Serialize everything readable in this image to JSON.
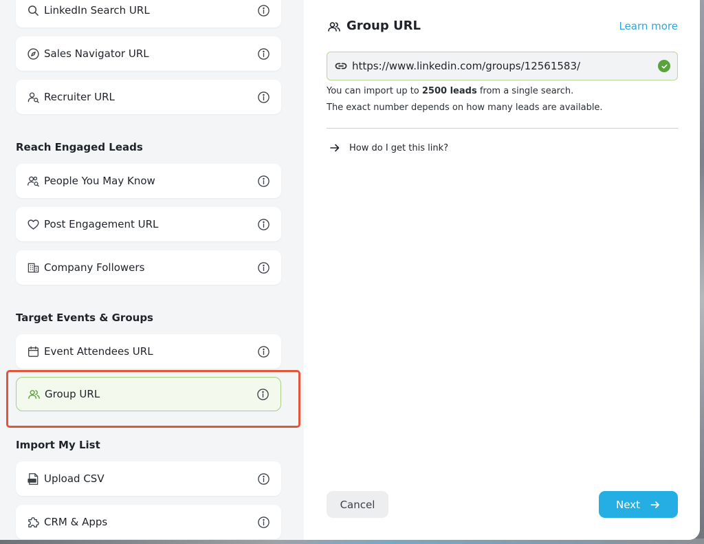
{
  "sidebar": {
    "sections": [
      {
        "title": "",
        "items": [
          {
            "label": "LinkedIn Search URL",
            "icon": "search-icon"
          },
          {
            "label": "Sales Navigator URL",
            "icon": "compass-icon"
          },
          {
            "label": "Recruiter URL",
            "icon": "user-search-icon"
          }
        ]
      },
      {
        "title": "Reach Engaged Leads",
        "items": [
          {
            "label": "People You May Know",
            "icon": "people-search-icon"
          },
          {
            "label": "Post Engagement URL",
            "icon": "heart-icon"
          },
          {
            "label": "Company Followers",
            "icon": "building-icon"
          }
        ]
      },
      {
        "title": "Target Events & Groups",
        "items": [
          {
            "label": "Event Attendees URL",
            "icon": "calendar-icon"
          },
          {
            "label": "Group URL",
            "icon": "group-icon",
            "selected": true
          }
        ]
      },
      {
        "title": "Import My List",
        "items": [
          {
            "label": "Upload CSV",
            "icon": "csv-file-icon"
          },
          {
            "label": "CRM & Apps",
            "icon": "puzzle-icon"
          }
        ]
      }
    ]
  },
  "panel": {
    "title": "Group URL",
    "learn_more": "Learn more",
    "url_value": "https://www.linkedin.com/groups/12561583/",
    "hint_prefix": "You can import up to ",
    "hint_bold": "2500 leads",
    "hint_suffix": " from a single search.",
    "hint_line2": "The exact number depends on how many leads are available.",
    "howto": "How do I get this link?",
    "cancel": "Cancel",
    "next": "Next"
  },
  "colors": {
    "accent": "#24aee4",
    "success": "#5aa23b",
    "highlight": "#e0563a"
  }
}
